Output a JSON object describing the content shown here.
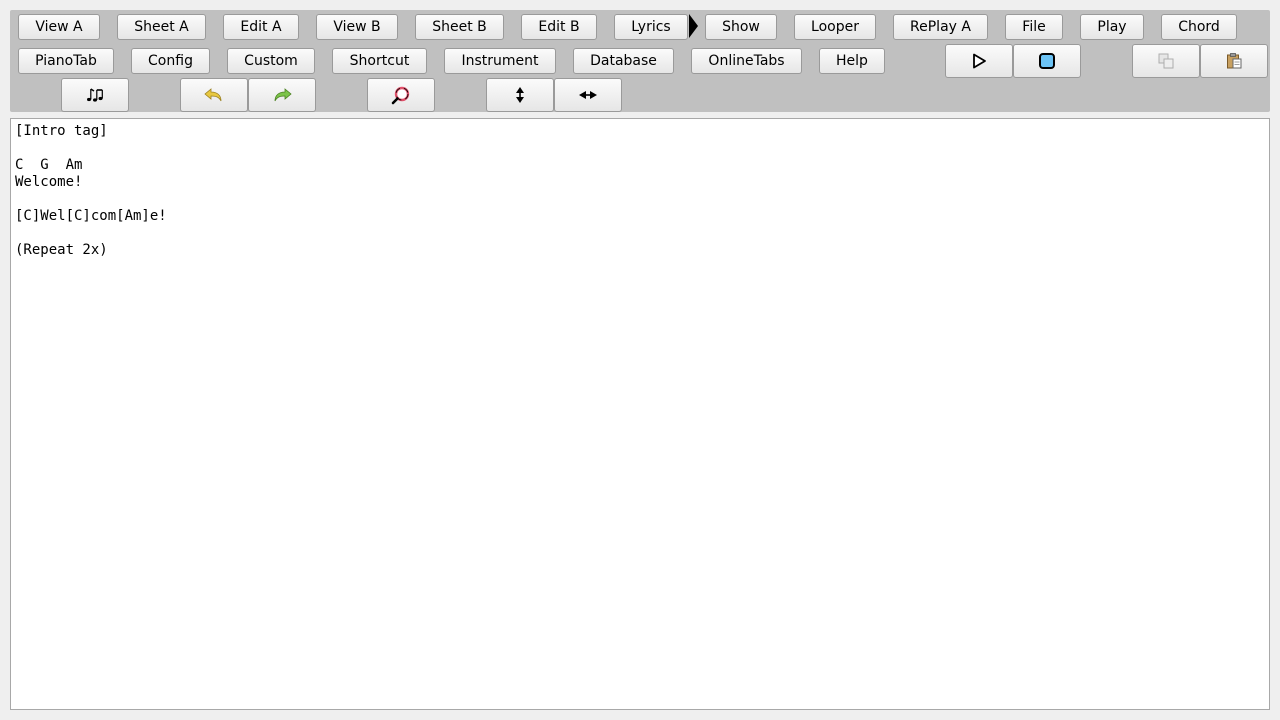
{
  "toolbar": {
    "row1": {
      "view_a": "View A",
      "sheet_a": "Sheet A",
      "edit_a": "Edit A",
      "view_b": "View B",
      "sheet_b": "Sheet B",
      "edit_b": "Edit B",
      "lyrics": "Lyrics",
      "show": "Show",
      "looper": "Looper",
      "replay_a": "RePlay A",
      "file": "File",
      "play": "Play",
      "chord": "Chord"
    },
    "row2": {
      "pianotab": "PianoTab",
      "config": "Config",
      "custom": "Custom",
      "shortcut": "Shortcut",
      "instrument": "Instrument",
      "database": "Database",
      "onlinetabs": "OnlineTabs",
      "help": "Help"
    },
    "icons": {
      "play": "play-icon",
      "stop": "stop-icon",
      "copy": "copy-icon",
      "paste": "paste-icon",
      "notes": "music-notes-icon",
      "undo": "undo-icon",
      "redo": "redo-icon",
      "search": "search-icon",
      "vertical_resize": "vertical-resize-icon",
      "horizontal_resize": "horizontal-resize-icon"
    },
    "colors": {
      "stop_fill": "#6cc3f5",
      "undo": "#e8c840",
      "redo": "#7cc44a",
      "search": "#e0506a"
    }
  },
  "editor": {
    "lines": [
      "[Intro tag]",
      "",
      "C  G  Am",
      "Welcome!",
      "",
      "[C]Wel[C]com[Am]e!",
      "",
      "(Repeat 2x)"
    ]
  }
}
